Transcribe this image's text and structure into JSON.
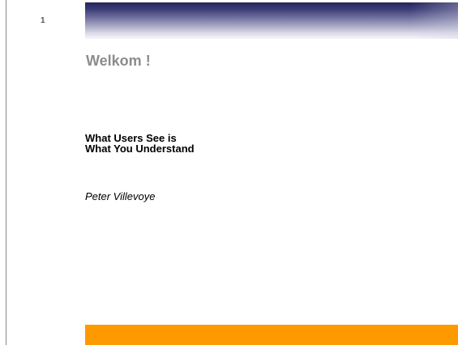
{
  "slide": {
    "number": "1",
    "welcome": "Welkom !",
    "title_line1": "What Users See is",
    "title_line2": "What You Understand",
    "author": "Peter Villevoye"
  },
  "colors": {
    "header_band": "#3a3a75",
    "footer_band": "#ff9900",
    "welcome_text": "#8c8c8c"
  }
}
